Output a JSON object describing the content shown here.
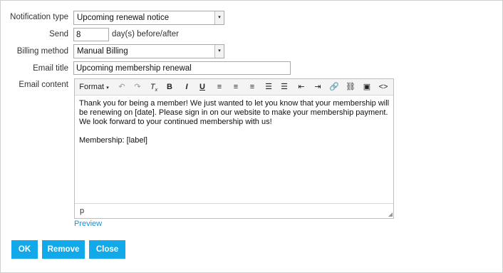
{
  "form": {
    "notification_type_label": "Notification type",
    "notification_type_value": "Upcoming renewal notice",
    "send_label": "Send",
    "send_value": "8",
    "send_suffix": "day(s) before/after",
    "billing_method_label": "Billing method",
    "billing_method_value": "Manual Billing",
    "email_title_label": "Email title",
    "email_title_value": "Upcoming membership renewal",
    "email_content_label": "Email content"
  },
  "editor": {
    "toolbar": {
      "format_label": "Format",
      "icons": [
        "undo-icon",
        "redo-icon",
        "clear-format-icon",
        "bold-icon",
        "italic-icon",
        "underline-icon",
        "align-left-icon",
        "align-center-icon",
        "align-right-icon",
        "bulleted-list-icon",
        "numbered-list-icon",
        "outdent-icon",
        "indent-icon",
        "link-icon",
        "unlink-icon",
        "image-icon",
        "source-code-icon"
      ]
    },
    "paragraphs": [
      "Thank you for being a member! We just wanted to let you know that your membership will be renewing on [date]. Please sign in on our website to make your membership payment. We look forward to your continued membership with us!",
      "Membership: [label]"
    ],
    "status_path": "p"
  },
  "preview_link": "Preview",
  "buttons": {
    "ok": "OK",
    "remove": "Remove",
    "close": "Close"
  },
  "colors": {
    "accent": "#12a9ea",
    "link": "#1a8fd6"
  }
}
